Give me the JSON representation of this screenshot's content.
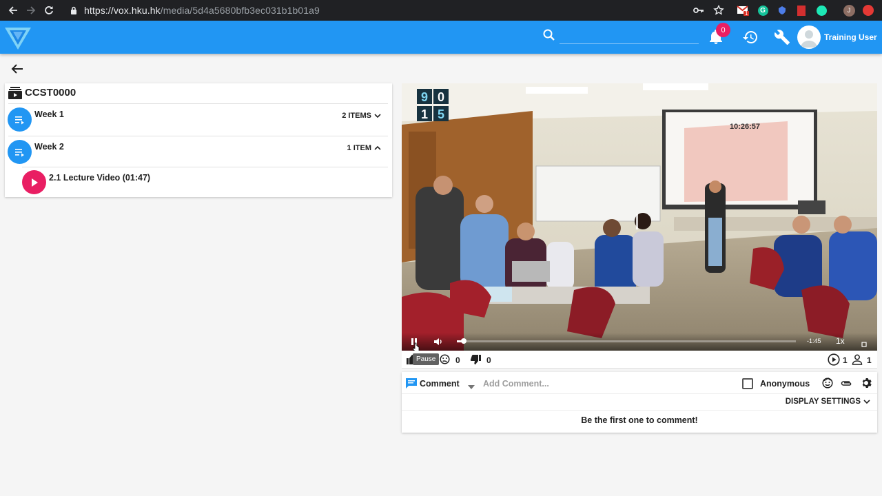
{
  "browser": {
    "url_host": "https://vox.hku.hk",
    "url_path": "/media/5d4a5680bfb3ec031b1b01a9",
    "profile_initial": "J",
    "mail_badge": "1"
  },
  "appbar": {
    "search_placeholder": "",
    "notification_count": "0",
    "username": "Training User"
  },
  "course": {
    "title": "CCST0000",
    "weeks": [
      {
        "label": "Week 1",
        "count": "2 ITEMS",
        "expanded": false
      },
      {
        "label": "Week 2",
        "count": "1 ITEM",
        "expanded": true
      }
    ],
    "video_item": "2.1 Lecture Video (01:47)"
  },
  "player": {
    "overlay_digits": [
      "9",
      "0",
      "1",
      "5"
    ],
    "clock_on_screen": "10:26:57",
    "progress": 0.02,
    "remaining": "-1:45",
    "speed": "1x",
    "tooltip": "Pause"
  },
  "reactions": {
    "like_count": "",
    "confused_count": "0",
    "dislike_count": "0",
    "views": "1",
    "viewers": "1"
  },
  "comments": {
    "type_label": "Comment",
    "placeholder": "Add Comment...",
    "anonymous_label": "Anonymous",
    "display_settings": "DISPLAY SETTINGS",
    "empty_message": "Be the first one to comment!"
  },
  "colors": {
    "primary": "#2196f3",
    "accent": "#e91e63",
    "chrome": "#202124"
  }
}
